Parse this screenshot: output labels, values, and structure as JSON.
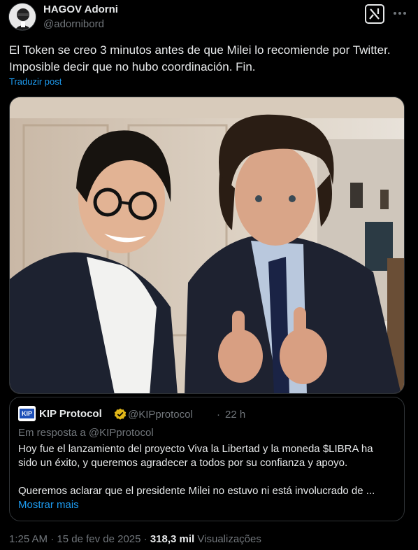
{
  "author": {
    "name": "HAGOV Adorni",
    "handle": "@adornibord"
  },
  "header_icons": {
    "grok": "grok-icon",
    "more": "more-icon"
  },
  "tweet": {
    "text_lines": [
      "El Token se creo 3 minutos antes de que Milei lo recomiende por Twitter.",
      "Imposible decir que no hubo coordinación. Fin."
    ],
    "translate_label": "Traduzir post"
  },
  "quoted": {
    "logo_text": "KIP",
    "name": "KIP Protocol",
    "handle": "@KIPprotocol",
    "separator": "·",
    "time": "22 h",
    "reply_to": "Em resposta a @KIPprotocol",
    "text_lines": [
      "Hoy fue el lanzamiento del proyecto Viva la Libertad y la moneda $LIBRA ha",
      "sido un éxito, y queremos agradecer a todos por su confianza y apoyo.",
      "",
      "Queremos aclarar que el presidente Milei no estuvo ni está involucrado de ..."
    ],
    "show_more": "Mostrar mais"
  },
  "meta": {
    "time": "1:25 AM",
    "date": "15 de fev de 2025",
    "separator": "·",
    "views_count": "318,3 mil",
    "views_label": "Visualizações"
  },
  "colors": {
    "background": "#000000",
    "text": "#e7e9ea",
    "muted": "#71767b",
    "link": "#1d9bf0",
    "border": "#2f3336",
    "verified": "#e2b719"
  }
}
